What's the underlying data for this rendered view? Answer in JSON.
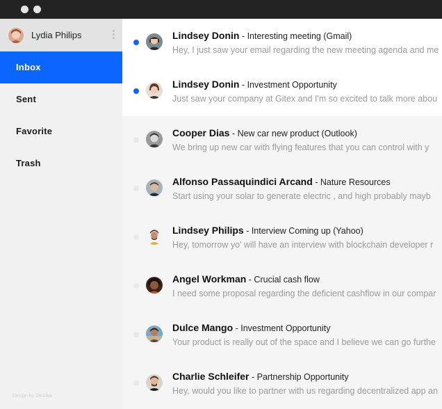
{
  "window": {
    "controls": [
      "window-dot",
      "window-dot"
    ]
  },
  "sidebar": {
    "user_name": "Lydia Philips",
    "nav": [
      {
        "id": "inbox",
        "label": "Inbox",
        "active": true
      },
      {
        "id": "sent",
        "label": "Sent",
        "active": false
      },
      {
        "id": "favorite",
        "label": "Favorite",
        "active": false
      },
      {
        "id": "trash",
        "label": "Trash",
        "active": false
      }
    ],
    "credit": "Design by Zenoba"
  },
  "colors": {
    "accent": "#0a66ff",
    "sidebar_bg": "#f1f1f1",
    "titlebar": "#232323"
  },
  "emails": [
    {
      "sender": "Lindsey Donin",
      "separator": " - ",
      "subject": "Interesting meeting (Gmail)",
      "preview": "Hey, I just saw your email regarding the new meeting agenda and me",
      "unread": true
    },
    {
      "sender": "Lindsey Donin",
      "separator": " - ",
      "subject": "Investment Opportunity",
      "preview": "Just saw your company at Gitex and I'm so excited to talk more abou",
      "unread": true
    },
    {
      "sender": "Cooper Dias",
      "separator": " - ",
      "subject": "New car new product (Outlook)",
      "preview": "We bring up new car with flying features that you can control with y",
      "unread": false
    },
    {
      "sender": "Alfonso Passaquindici Arcand",
      "separator": " - ",
      "subject": "Nature Resources",
      "preview": "Start using your solar to generate electric , and high probably mayb",
      "unread": false
    },
    {
      "sender": "Lindsey Philips",
      "separator": " - ",
      "subject": "Interview Coming up (Yahoo)",
      "preview": "Hey, tomorrow yo' will have an interview with blockchain developer r",
      "unread": false
    },
    {
      "sender": "Angel Workman",
      "separator": " - ",
      "subject": "Crucial cash flow",
      "preview": "I need some proposal regarding the deficient cashflow in our compar",
      "unread": false
    },
    {
      "sender": "Dulce Mango",
      "separator": " - ",
      "subject": "Investment Opportunity",
      "preview": "Your product is really out of the space and I believe we can go furthe",
      "unread": false
    },
    {
      "sender": "Charlie Schleifer",
      "separator": " - ",
      "subject": "Partnership Opportunity",
      "preview": "Hey, would you like to partner with us regarding decentralized app an",
      "unread": false
    }
  ]
}
